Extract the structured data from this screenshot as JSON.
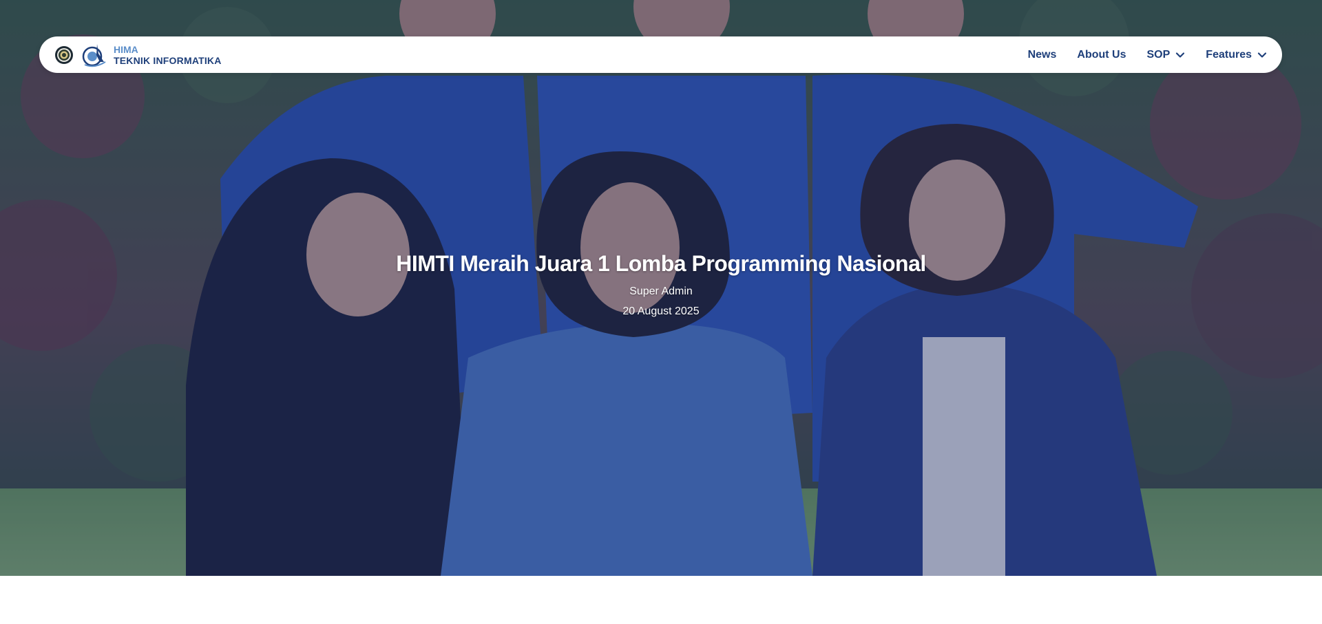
{
  "brand": {
    "line1": "HIMA",
    "line2": "TEKNIK INFORMATIKA",
    "university_logo_icon": "university-seal-icon",
    "hima_logo_icon": "hima-informatika-logo-icon"
  },
  "nav": {
    "items": [
      {
        "label": "News",
        "has_dropdown": false
      },
      {
        "label": "About Us",
        "has_dropdown": false
      },
      {
        "label": "SOP",
        "has_dropdown": true
      },
      {
        "label": "Features",
        "has_dropdown": true
      }
    ]
  },
  "hero": {
    "title": "HIMTI Meraih Juara 1 Lomba Programming Nasional",
    "author": "Super Admin",
    "date": "20 August 2025",
    "overlay_color": "#1e3282"
  },
  "colors": {
    "brand_dark": "#1e3f7a",
    "brand_light": "#5b8ec9",
    "nav_bg": "#ffffff"
  }
}
